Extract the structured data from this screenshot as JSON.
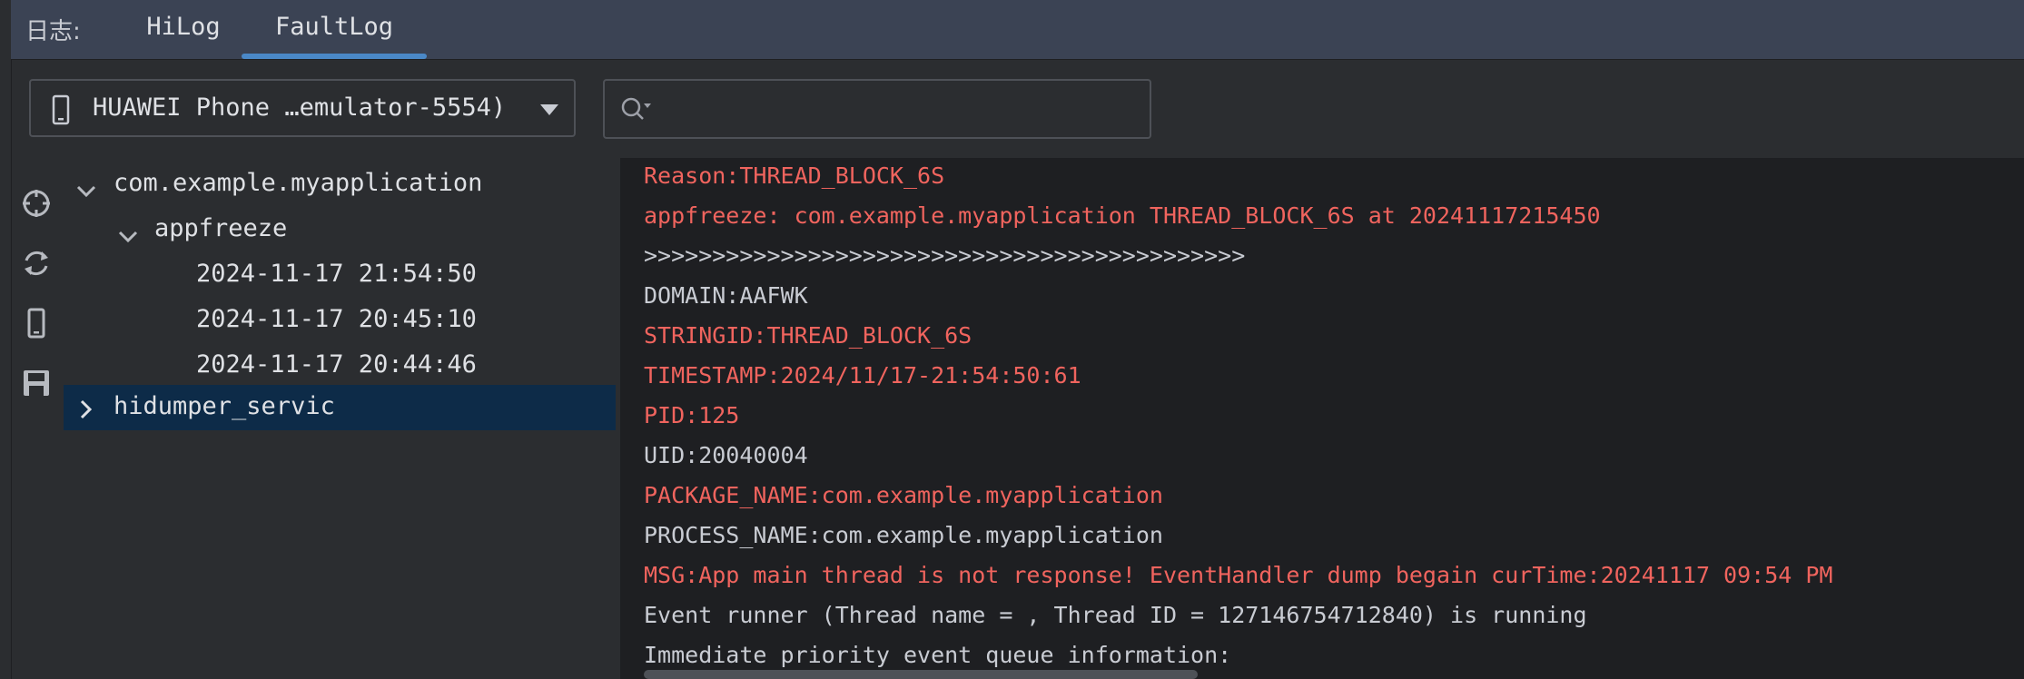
{
  "tabs": {
    "prefix": "日志:",
    "items": [
      {
        "label": "HiLog"
      },
      {
        "label": "FaultLog",
        "active": true
      }
    ]
  },
  "device": {
    "label": "HUAWEI Phone …emulator-5554)"
  },
  "search": {
    "value": "",
    "placeholder": ""
  },
  "toolbar": {
    "icons": [
      "locate-icon",
      "refresh-icon",
      "phone-icon",
      "save-icon"
    ]
  },
  "tree": {
    "rows": [
      {
        "label": "com.example.myapplication",
        "expanded": true
      },
      {
        "label": "appfreeze",
        "expanded": true
      },
      {
        "label": "2024-11-17 21:54:50"
      },
      {
        "label": "2024-11-17 20:45:10"
      },
      {
        "label": "2024-11-17 20:44:46"
      },
      {
        "label": "hidumper_servic",
        "expanded": false,
        "selected": true
      }
    ]
  },
  "log": {
    "lines": [
      {
        "text": "Reason:THREAD_BLOCK_6S",
        "level": "err"
      },
      {
        "text": "appfreeze: com.example.myapplication THREAD_BLOCK_6S at 20241117215450",
        "level": "err"
      },
      {
        "text": ">>>>>>>>>>>>>>>>>>>>>>>>>>>>>>>>>>>>>>>>>>>>",
        "level": "info"
      },
      {
        "text": "DOMAIN:AAFWK",
        "level": "info"
      },
      {
        "text": "STRINGID:THREAD_BLOCK_6S",
        "level": "err"
      },
      {
        "text": "TIMESTAMP:2024/11/17-21:54:50:61",
        "level": "err"
      },
      {
        "text": "PID:125",
        "level": "err"
      },
      {
        "text": "UID:20040004",
        "level": "info"
      },
      {
        "text": "PACKAGE_NAME:com.example.myapplication",
        "level": "err"
      },
      {
        "text": "PROCESS_NAME:com.example.myapplication",
        "level": "info"
      },
      {
        "text": "MSG:App main thread is not response! EventHandler dump begain curTime:20241117 09:54 PM",
        "level": "err"
      },
      {
        "text": "Event runner (Thread name = , Thread ID = 127146754712840) is running",
        "level": "info"
      },
      {
        "text": "Immediate priority event queue information:",
        "level": "info"
      }
    ]
  },
  "colors": {
    "accent": "#4a88c7",
    "error_text": "#f0645e",
    "info_text": "#c9ccd3",
    "selection": "#0d2b48",
    "tabbar": "#3b4354",
    "log_background": "#1e1f22"
  }
}
